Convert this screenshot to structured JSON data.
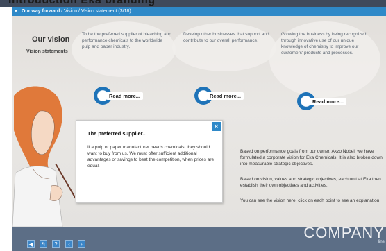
{
  "header": {
    "title": "Introduction Eka branding",
    "breadcrumb": {
      "current": "Our way forward",
      "path": " / Vision / Vision statement (3/18)"
    }
  },
  "vision": {
    "heading": "Our vision",
    "subheading": "Vision statements",
    "columns": [
      {
        "text": "To be the preferred supplier of bleaching and performance chemicals to the worldwide pulp and paper industry."
      },
      {
        "text": "Develop other businesses that support and contribute to our overall performance."
      },
      {
        "text": "Growing the business by being recognized through innovative use of our unique knowledge of chemistry to improve our customers' products and processes."
      }
    ],
    "read_more": [
      "Read more...",
      "Read more...",
      "Read more..."
    ]
  },
  "popup": {
    "title": "The preferred supplier...",
    "body": "If a pulp or paper manufacturer needs chemicals, they should want to buy from us. We must offer sufficient additional advantages or savings to beat the competition, when prices are equal.",
    "close_icon": "×"
  },
  "info": {
    "paragraphs": [
      "Based on performance goals from our owner, Akzo Nobel, we have formulated a corporate vision for Eka Chemicals. It is also broken down into measurable strategic objectives.",
      "Based on vision, values and strategic objectives, each unit at Eka then establish their own objectives and activities.",
      "You can see the vision here, click on each point to see an explanation."
    ]
  },
  "footer": {
    "nav": [
      {
        "icon": "skip-back-icon",
        "glyph": "◀"
      },
      {
        "icon": "return-icon",
        "glyph": "↰"
      },
      {
        "icon": "help-icon",
        "glyph": "?"
      },
      {
        "icon": "previous-icon",
        "glyph": "‹"
      },
      {
        "icon": "next-icon",
        "glyph": "›"
      }
    ],
    "brand": "COMPANY",
    "brand_sub": "line"
  },
  "colors": {
    "accent": "#2f89c8",
    "footer": "#5c6e86",
    "stage": "#e4e2df"
  }
}
